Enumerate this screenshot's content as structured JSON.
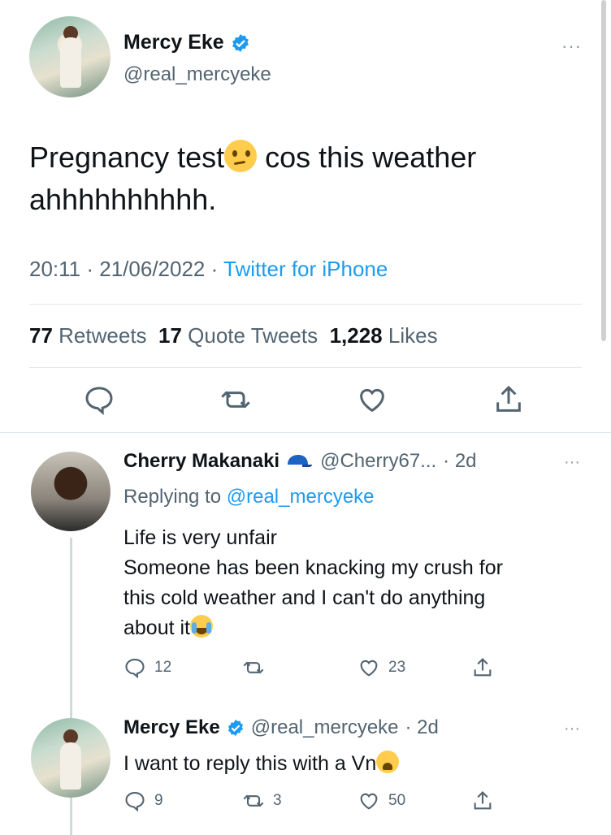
{
  "tweet": {
    "name": "Mercy Eke",
    "handle": "@real_mercyeke",
    "text_before_emoji": "Pregnancy test",
    "text_after_emoji": " cos this weather ahhhhhhhhhh.",
    "time": "20:11",
    "date": "21/06/2022",
    "source": "Twitter for iPhone",
    "stats": {
      "retweets_count": "77",
      "retweets_label": "Retweets",
      "quotes_count": "17",
      "quotes_label": "Quote Tweets",
      "likes_count": "1,228",
      "likes_label": "Likes"
    }
  },
  "replies": [
    {
      "name": "Cherry Makanaki",
      "handle": "@Cherry67...",
      "age": "· 2d",
      "replying_prefix": "Replying to ",
      "replying_to": "@real_mercyeke",
      "lines": [
        "Life is very unfair",
        "Someone has been knacking my crush for",
        "this cold weather and I can't do anything",
        "about it"
      ],
      "reply_count": "12",
      "retweet_count": "",
      "like_count": "23"
    },
    {
      "name": "Mercy Eke",
      "handle": "@real_mercyeke",
      "age": "· 2d",
      "text": "I want to reply this with a Vn",
      "reply_count": "9",
      "retweet_count": "3",
      "like_count": "50"
    }
  ],
  "more_label": "···",
  "colors": {
    "accent": "#1d9bf0",
    "muted": "#536471"
  }
}
